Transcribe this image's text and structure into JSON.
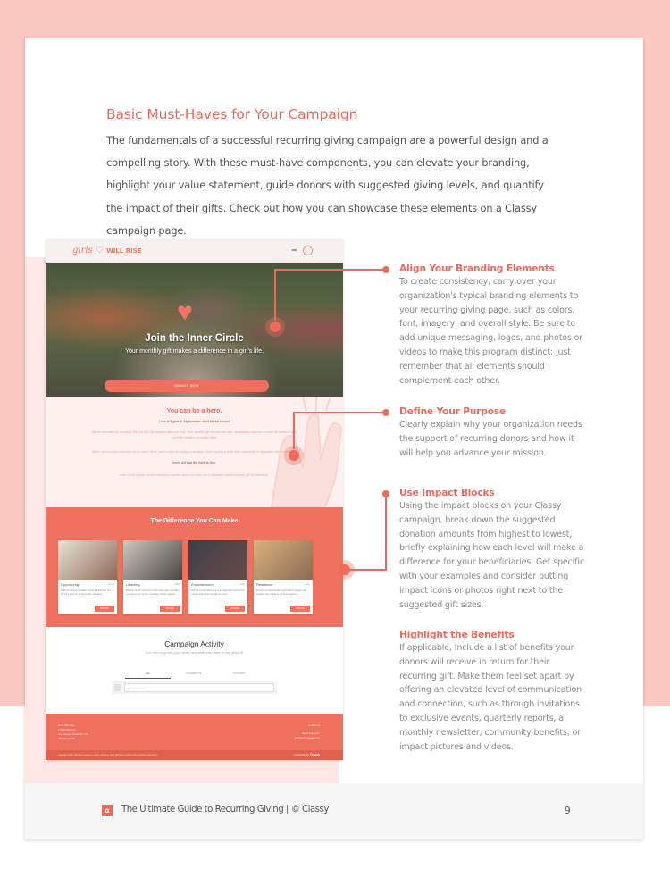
{
  "intro": {
    "title": "Basic Must-Haves for Your Campaign",
    "body": "The fundamentals of a successful recurring giving campaign are a powerful design and a compelling story. With these must-have components, you can elevate your branding, highlight your value statement, guide donors with suggested giving levels, and quantify the impact of their gifts. Check out how you can showcase these elements on a Classy campaign page."
  },
  "mockup": {
    "logo_script": "girls",
    "logo_heart": "♡",
    "logo_caps": "WILL RISE",
    "hero_title": "Join the Inner Circle",
    "hero_subtitle": "Your monthly gift makes a difference in a girl's life.",
    "donate_label": "DONATE NOW",
    "story": {
      "heading": "You can be a hero.",
      "stat": "1 out of 3 girls in Afghanistan don't attend school.",
      "p1": "We're committed to changing that, but it's only possible with your help. Your monthly gift ensures we have dependable revenue to meet the needs of girls and their families, no matter what.",
      "p2": "When you become a member of our Inner Circle, you're not only making a donation. You're joining a close-knit community of supporters who believe that",
      "p2_strong": "every girl has the right to rise.",
      "p3": "Inner Circle donors receive exclusive updates about our work and a specially curated monthly gift for members."
    },
    "impact_title": "The Difference You Can Make",
    "impact_cards": [
      {
        "title": "Opportunity",
        "amount": "$100",
        "desc": "$100 per month provides a school fellowship to a girl for a full year of secondary education.",
        "button": "DONATE",
        "colors": [
          "#e9e2da",
          "#8f6a55"
        ]
      },
      {
        "title": "Learning",
        "amount": "$50",
        "desc": "$50 per month covers the cost of five girls attending a course in our center, including school supplies.",
        "button": "DONATE",
        "colors": [
          "#cfc7c2",
          "#4a4645"
        ]
      },
      {
        "title": "Empowerment",
        "amount": "$25",
        "desc": "$25 per month allows us to provide after-school and weekend programs to girls in need.",
        "button": "DONATE",
        "colors": [
          "#3b3f4a",
          "#6a4a48"
        ]
      },
      {
        "title": "Resilience",
        "amount": "$10",
        "desc": "$10 per month provides a girl with the books and supplies she needs to continue learning.",
        "button": "DONATE",
        "colors": [
          "#d7b27c",
          "#8b6b55"
        ]
      }
    ],
    "activity": {
      "title": "Campaign Activity",
      "subtitle": "See who supports your cause and what they have to say about it!",
      "tabs": [
        "ALL",
        "COMMENTS",
        "DONORS"
      ],
      "input_placeholder": "Post a comment..."
    },
    "footer": {
      "org": "Girls Will Rise",
      "address1": "1234 Main Ave",
      "address2": "San Diego, CA 92101 US",
      "phone": "555-555-5555",
      "follow": "Follow us",
      "support": "Need Support?",
      "email": "hello@girlswillrise.org",
      "copyright": "Copyright 2019 • All rights reserved • Terms • Privacy • Girls Will Rise is a 501(c)(3) nonprofit organization",
      "powered_by": "POWERED BY",
      "powered_brand": "Classy"
    }
  },
  "callouts": [
    {
      "title": "Align Your Branding Elements",
      "body": "To create consistency, carry over your organization's typical branding elements to your recurring giving page, such as colors, font, imagery, and overall style. Be sure to add unique messaging, logos, and photos or videos to make this program distinct; just remember that all elements should complement each other."
    },
    {
      "title": "Define Your Purpose",
      "body": "Clearly explain why your organization needs the support of recurring donors and how it will help you advance your mission."
    },
    {
      "title": "Use Impact Blocks",
      "body": "Using the impact blocks on your Classy campaign, break down the suggested donation amounts from highest to lowest, briefly explaining how each level will make a difference for your beneficiaries. Get specific with your examples and consider putting impact icons or photos right next to the suggested gift sizes."
    },
    {
      "title": "Highlight the Benefits",
      "body": "If applicable, Include a list of benefits your donors will receive in return for their recurring gift. Make them feel set apart by offering an elevated level of communication and connection, such as through invitations to exclusive events, quarterly reports, a monthly newsletter, community benefits, or impact pictures and videos."
    }
  ],
  "footer": {
    "logo_glyph": "α",
    "text": "The Ultimate Guide to Recurring Giving  |  © Classy",
    "page_number": "9"
  },
  "colors": {
    "accent": "#ec6a5d",
    "background_pink": "#fcc8c2",
    "panel_pink": "#fde6e3",
    "impact_coral": "#ef7160"
  }
}
